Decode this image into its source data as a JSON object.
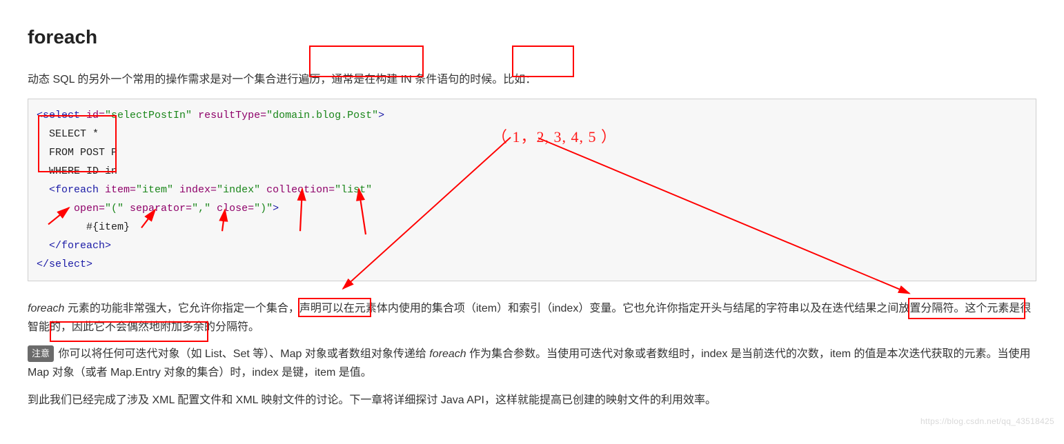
{
  "heading": "foreach",
  "intro_a": "动态 SQL 的另外一个常用的操作需求是对一",
  "intro_b": "个集合进行遍历",
  "intro_c": "，通常是在构建 ",
  "intro_d": "IN 条件语",
  "intro_e": "句的时候。比如：",
  "code": {
    "l1a": "<select",
    "l1b": " id=",
    "l1c": "\"selectPostIn\"",
    "l1d": " resultType=",
    "l1e": "\"domain.blog.Post\"",
    "l1f": ">",
    "l2": "  SELECT *",
    "l3": "  FROM POST P",
    "l4": "  WHERE ID in",
    "l5a": "  <foreach",
    "l5b": " item=",
    "l5c": "\"item\"",
    "l5d": " index=",
    "l5e": "\"index\"",
    "l5f": " collection=",
    "l5g": "\"list\"",
    "l6a": "      open=",
    "l6b": "\"(\"",
    "l6c": " separator=",
    "l6d": "\",\"",
    "l6e": " close=",
    "l6f": "\")\"",
    "l6g": ">",
    "l7": "        #{item}",
    "l8": "  </foreach>",
    "l9": "</select>"
  },
  "annotation_list": "（ 1，2, 3, 4, 5 ）",
  "p2_a": "foreach",
  "p2_b": " 元素的功能非常强大，它允许你指定",
  "p2_c": "一个集合",
  "p2_d": "，声明可以在元素体内使用的集合项（item）和索引（index）变量。它也允许你指定",
  "p2_e": "开头与结尾的字符",
  "p2_f": "串以及在",
  "p2_g": "迭代结果之间放置分隔符。",
  "p2_h": "这个元素是很智能的，因此它不会偶然地附加多余的分隔符。",
  "note_badge": "注意",
  "p3_a": " 你可以将任何可迭代对象（如 List、Set 等）、Map 对象或者数组对象传递给 ",
  "p3_b": "foreach",
  "p3_c": " 作为集合参数。当使用可迭代对象或者数组时，index 是当前迭代的次数，item 的值是本次迭代获取的元素。当使用 Map 对象（或者 Map.Entry 对象的集合）时，index 是键，item 是值。",
  "p4": "到此我们已经完成了涉及 XML 配置文件和 XML 映射文件的讨论。下一章将详细探讨 Java API，这样就能提高已创建的映射文件的利用效率。",
  "watermark": "https://blog.csdn.net/qq_43518425"
}
